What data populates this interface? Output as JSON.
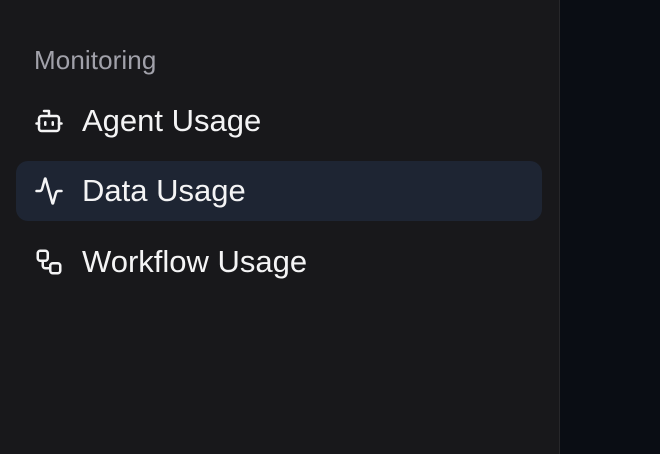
{
  "sidebar": {
    "section_title": "Monitoring",
    "items": [
      {
        "label": "Agent Usage",
        "icon": "bot-icon",
        "active": false
      },
      {
        "label": "Data Usage",
        "icon": "activity-icon",
        "active": true
      },
      {
        "label": "Workflow Usage",
        "icon": "workflow-icon",
        "active": false
      }
    ]
  },
  "colors": {
    "sidebar_bg": "#18181b",
    "active_bg": "#1e2533",
    "main_bg": "#0a0d14",
    "text": "#f4f4f5",
    "section_title": "#a1a1aa"
  }
}
